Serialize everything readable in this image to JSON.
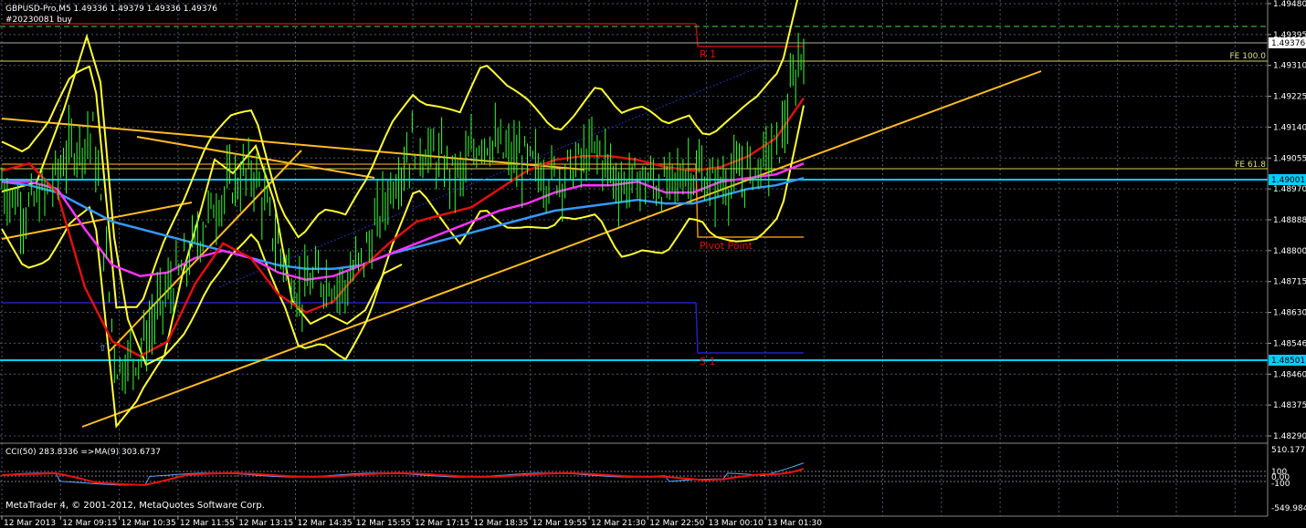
{
  "header": {
    "symbol_line": "GBPUSD-Pro,M5  1.49336 1.49379 1.49336 1.49376",
    "order_label": "#20230081 buy"
  },
  "indicator": {
    "label": "CCI(50) 283.8336  =>MA(9) 303.6737",
    "axis_labels": [
      "510.1772",
      "100",
      "0.00",
      "-100",
      "-549.984"
    ]
  },
  "footer": {
    "copyright": "MetaTrader 4, © 2001-2012, MetaQuotes Software Corp."
  },
  "annotations": {
    "r1": "R 1",
    "pivot": "Pivot Point",
    "s1": "S 1",
    "fe100": "FE 100.0",
    "fe618": "FE 61.8"
  },
  "colors": {
    "background": "#000000",
    "candles": "#33ff33",
    "bollinger": "#ffff33",
    "ma_red": "#e01010",
    "ma_magenta": "#ff33ff",
    "ma_blue": "#3399ff",
    "trendline": "#ffbb22",
    "horizontal": "#00ccff",
    "grid": "#5a6a7a"
  },
  "chart_data": {
    "type": "line",
    "y_axis": {
      "ticks": [
        "1.49480",
        "1.49395",
        "1.49310",
        "1.49225",
        "1.49140",
        "1.49055",
        "1.48970",
        "1.48888",
        "1.48800",
        "1.48715",
        "1.48630",
        "1.48546",
        "1.48460",
        "1.48375",
        "1.48290"
      ],
      "current_price": "1.49376",
      "levels": [
        "1.49001",
        "1.48501"
      ],
      "ylim": [
        1.4829,
        1.4948
      ]
    },
    "x_axis": {
      "ticks": [
        "12 Mar 2013",
        "12 Mar 09:15",
        "12 Mar 10:35",
        "12 Mar 11:55",
        "12 Mar 13:15",
        "12 Mar 14:35",
        "12 Mar 15:55",
        "12 Mar 17:15",
        "12 Mar 18:35",
        "12 Mar 19:55",
        "12 Mar 21:30",
        "12 Mar 22:50",
        "13 Mar 00:10",
        "13 Mar 01:30"
      ]
    },
    "series": [
      {
        "values": [
          1.4898,
          1.4891,
          1.4896,
          1.4908,
          1.4912,
          1.4848,
          1.4852,
          1.4866,
          1.4876,
          1.489,
          1.4898,
          1.4902,
          1.4882,
          1.4868,
          1.4873,
          1.487,
          1.4881,
          1.4898,
          1.491,
          1.4905,
          1.49,
          1.4912,
          1.4906,
          1.4904,
          1.49,
          1.4903,
          1.4908,
          1.4898,
          1.49,
          1.4897,
          1.4903,
          1.4898,
          1.49,
          1.4903,
          1.491,
          1.4938
        ]
      },
      {
        "values": [
          1.4902,
          1.4904,
          1.4896,
          1.487,
          1.4855,
          1.4851,
          1.4855,
          1.4871,
          1.4882,
          1.4878,
          1.4868,
          1.4863,
          1.4866,
          1.4875,
          1.4882,
          1.4888,
          1.489,
          1.4892,
          1.4897,
          1.4902,
          1.4905,
          1.4906,
          1.4906,
          1.4905,
          1.4903,
          1.4902,
          1.4903,
          1.4906,
          1.4911,
          1.4922
        ]
      },
      {
        "values": [
          1.4899,
          1.4899,
          1.4897,
          1.4886,
          1.4876,
          1.4873,
          1.4874,
          1.4878,
          1.488,
          1.4878,
          1.4874,
          1.4872,
          1.4873,
          1.4876,
          1.4879,
          1.4882,
          1.4885,
          1.4888,
          1.4891,
          1.4893,
          1.4896,
          1.4898,
          1.4898,
          1.4899,
          1.4896,
          1.4896,
          1.4899,
          1.49,
          1.4901,
          1.4904
        ]
      },
      {
        "values": [
          1.4899,
          1.4898,
          1.4896,
          1.4892,
          1.4888,
          1.4886,
          1.4884,
          1.4882,
          1.488,
          1.4878,
          1.4876,
          1.4875,
          1.4875,
          1.4876,
          1.4879,
          1.4881,
          1.4883,
          1.4885,
          1.4887,
          1.4889,
          1.4891,
          1.4892,
          1.4893,
          1.4894,
          1.4893,
          1.4893,
          1.4895,
          1.4897,
          1.4898,
          1.49
        ]
      }
    ]
  }
}
